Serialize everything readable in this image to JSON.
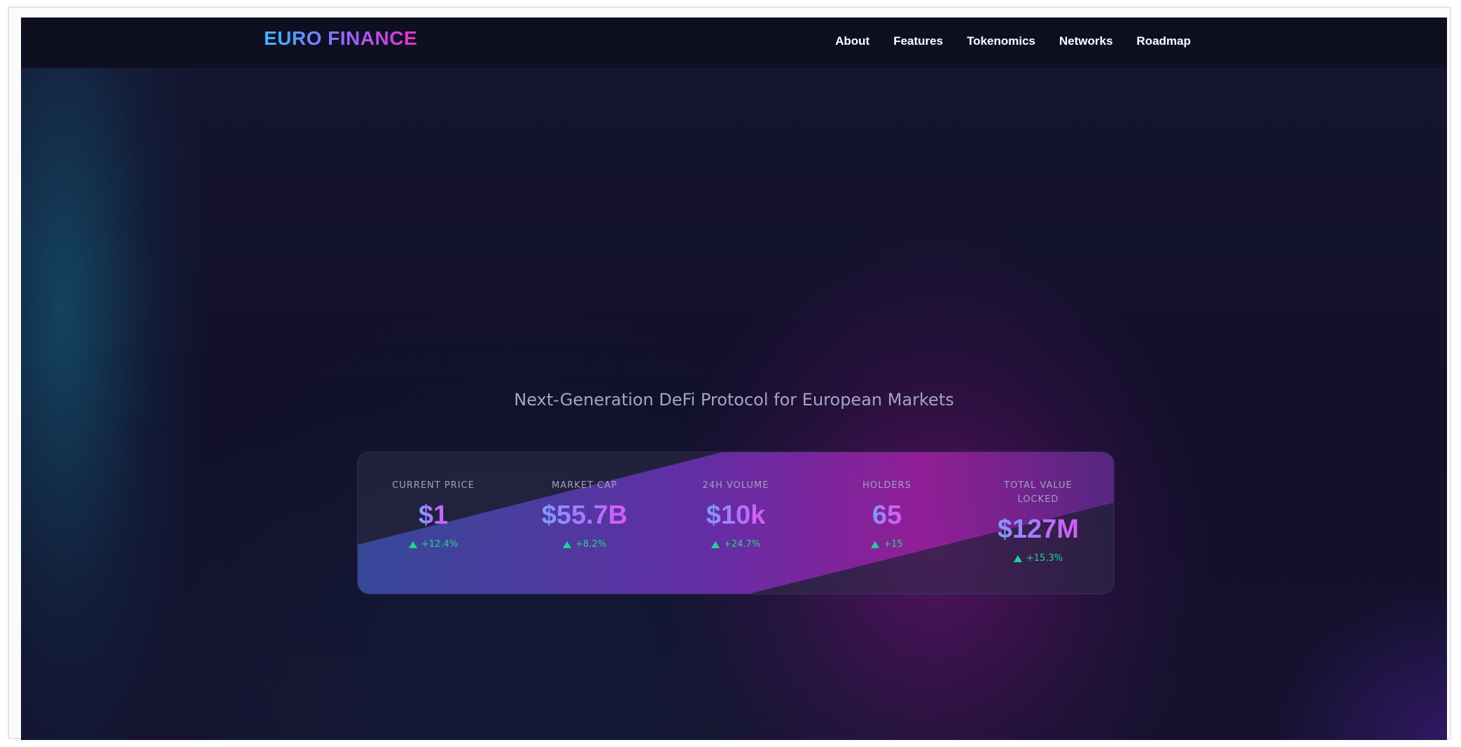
{
  "brand": {
    "logo_text": "EURO FINANCE"
  },
  "nav": {
    "items": [
      {
        "label": "About"
      },
      {
        "label": "Features"
      },
      {
        "label": "Tokenomics"
      },
      {
        "label": "Networks"
      },
      {
        "label": "Roadmap"
      }
    ]
  },
  "hero": {
    "tagline": "Next-Generation DeFi Protocol for European Markets"
  },
  "stats": [
    {
      "label": "CURRENT PRICE",
      "value": "$1",
      "change": "+12.4%"
    },
    {
      "label": "MARKET CAP",
      "value": "$55.7B",
      "change": "+8.2%"
    },
    {
      "label": "24H VOLUME",
      "value": "$10k",
      "change": "+24.7%"
    },
    {
      "label": "HOLDERS",
      "value": "65",
      "change": "+15"
    },
    {
      "label": "TOTAL VALUE LOCKED",
      "value": "$127M",
      "change": "+15.3%"
    }
  ],
  "colors": {
    "background": "#11122a",
    "accent_blue": "#39b9ff",
    "accent_pink": "#e532c8",
    "positive": "#22d48f"
  },
  "icons": {
    "change_indicator": "triangle-up-icon"
  }
}
